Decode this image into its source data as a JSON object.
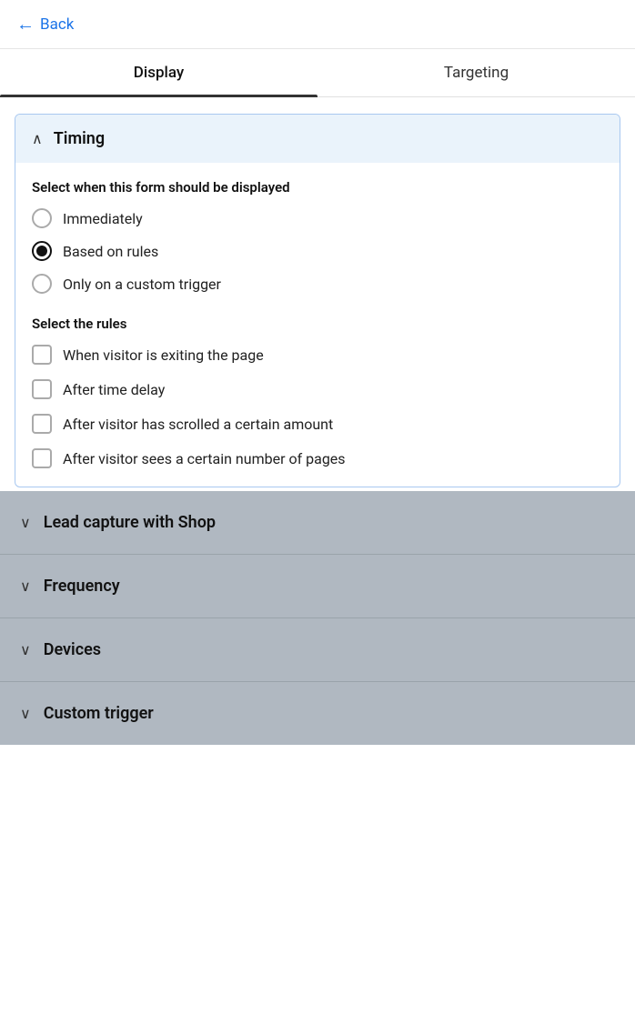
{
  "header": {
    "back_label": "Back"
  },
  "tabs": [
    {
      "id": "display",
      "label": "Display",
      "active": true
    },
    {
      "id": "targeting",
      "label": "Targeting",
      "active": false
    }
  ],
  "timing": {
    "section_title": "Timing",
    "expanded": true,
    "display_label": "Select when this form should be displayed",
    "display_options": [
      {
        "id": "immediately",
        "label": "Immediately",
        "checked": false
      },
      {
        "id": "based_on_rules",
        "label": "Based on rules",
        "checked": true
      },
      {
        "id": "custom_trigger",
        "label": "Only on a custom trigger",
        "checked": false
      }
    ],
    "rules_label": "Select the rules",
    "rules_options": [
      {
        "id": "exit",
        "label": "When visitor is exiting the page",
        "checked": false
      },
      {
        "id": "time_delay",
        "label": "After time delay",
        "checked": false
      },
      {
        "id": "scroll",
        "label": "After visitor has scrolled a certain amount",
        "checked": false
      },
      {
        "id": "pages",
        "label": "After visitor sees a certain number of pages",
        "checked": false
      }
    ]
  },
  "collapsed_sections": [
    {
      "id": "lead_capture",
      "label": "Lead capture with Shop"
    },
    {
      "id": "frequency",
      "label": "Frequency"
    },
    {
      "id": "devices",
      "label": "Devices"
    },
    {
      "id": "custom_trigger",
      "label": "Custom trigger"
    }
  ]
}
